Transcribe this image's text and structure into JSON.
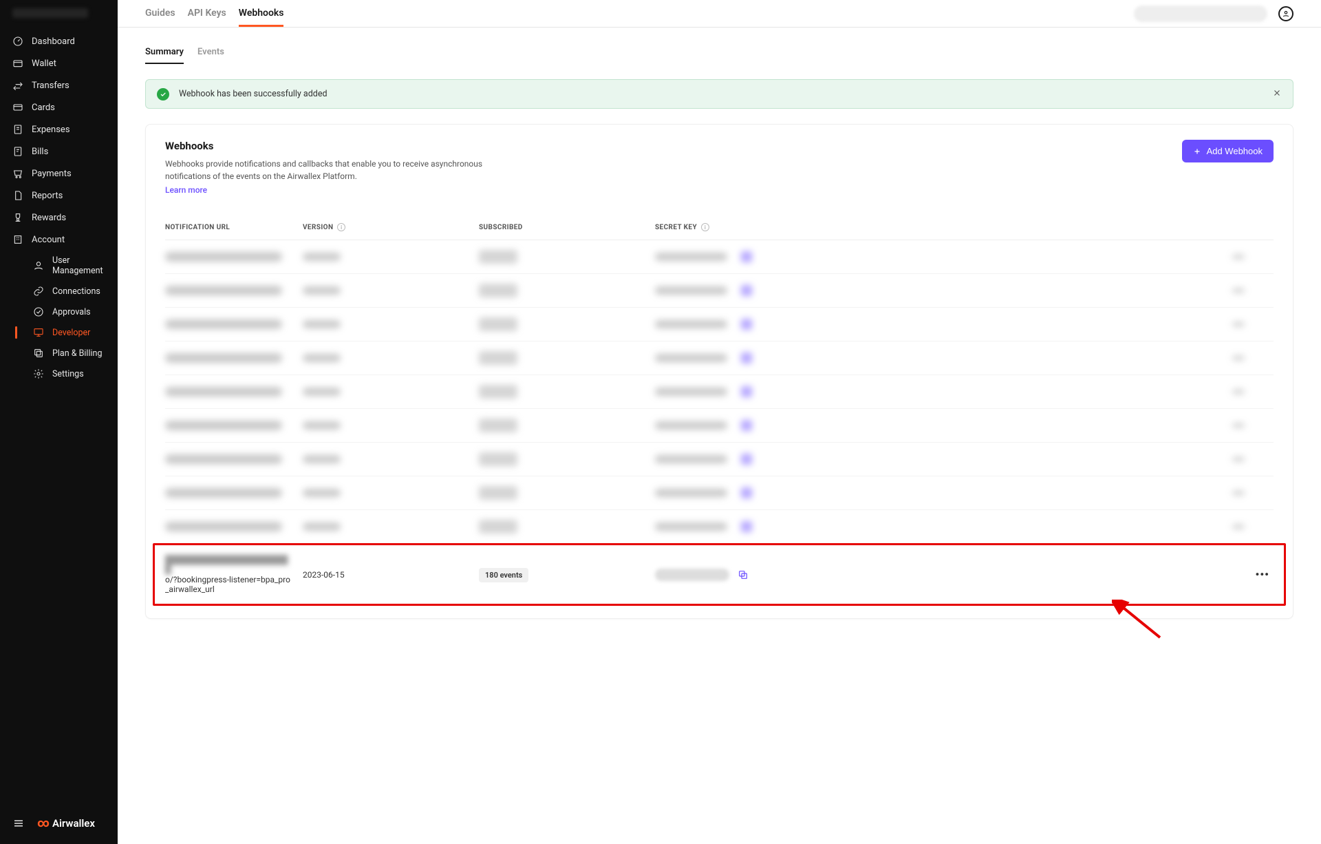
{
  "sidebar": {
    "items": [
      {
        "label": "Dashboard"
      },
      {
        "label": "Wallet"
      },
      {
        "label": "Transfers"
      },
      {
        "label": "Cards"
      },
      {
        "label": "Expenses"
      },
      {
        "label": "Bills"
      },
      {
        "label": "Payments"
      },
      {
        "label": "Reports"
      },
      {
        "label": "Rewards"
      },
      {
        "label": "Account"
      }
    ],
    "subitems": [
      {
        "label": "User Management"
      },
      {
        "label": "Connections"
      },
      {
        "label": "Approvals"
      },
      {
        "label": "Developer"
      },
      {
        "label": "Plan & Billing"
      },
      {
        "label": "Settings"
      }
    ],
    "brand": "Airwallex"
  },
  "topTabs": [
    {
      "label": "Guides"
    },
    {
      "label": "API Keys"
    },
    {
      "label": "Webhooks"
    }
  ],
  "subTabs": [
    {
      "label": "Summary"
    },
    {
      "label": "Events"
    }
  ],
  "alert": {
    "message": "Webhook has been successfully added"
  },
  "panel": {
    "title": "Webhooks",
    "description": "Webhooks provide notifications and callbacks that enable you to receive asynchronous notifications of the events on the Airwallex Platform.",
    "learnMore": "Learn more",
    "addButton": "Add Webhook"
  },
  "table": {
    "headers": {
      "url": "NOTIFICATION URL",
      "version": "VERSION",
      "subscribed": "SUBSCRIBED",
      "secret": "SECRET KEY"
    },
    "highlightRow": {
      "url": "o/?bookingpress-listener=bpa_pro_airwallex_url",
      "version": "2023-06-15",
      "subscribed": "180 events"
    }
  }
}
